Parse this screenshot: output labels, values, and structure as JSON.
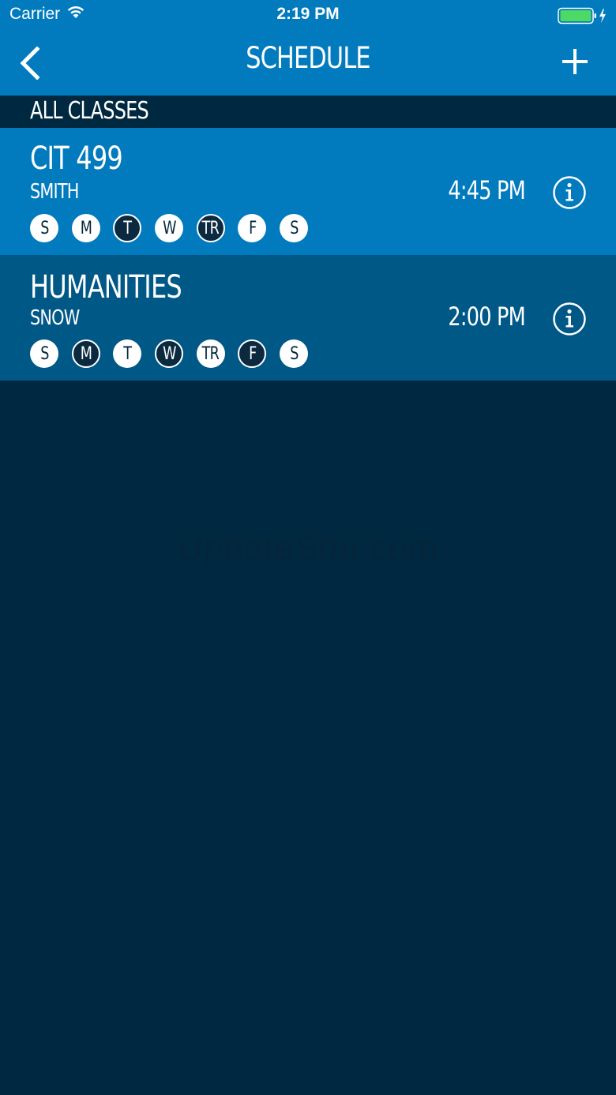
{
  "status_bar": {
    "carrier": "Carrier",
    "time": "2:19 PM"
  },
  "nav": {
    "title": "SCHEDULE"
  },
  "section": {
    "title": "ALL CLASSES"
  },
  "classes": [
    {
      "name": "CIT 499",
      "instructor": "SMITH",
      "time": "4:45 PM",
      "days": [
        {
          "label": "S",
          "selected": false
        },
        {
          "label": "M",
          "selected": false
        },
        {
          "label": "T",
          "selected": true
        },
        {
          "label": "W",
          "selected": false
        },
        {
          "label": "TR",
          "selected": true
        },
        {
          "label": "F",
          "selected": false
        },
        {
          "label": "S",
          "selected": false
        }
      ]
    },
    {
      "name": "HUMANITIES",
      "instructor": "SNOW",
      "time": "2:00 PM",
      "days": [
        {
          "label": "S",
          "selected": false
        },
        {
          "label": "M",
          "selected": true
        },
        {
          "label": "T",
          "selected": false
        },
        {
          "label": "W",
          "selected": true
        },
        {
          "label": "TR",
          "selected": false
        },
        {
          "label": "F",
          "selected": true
        },
        {
          "label": "S",
          "selected": false
        }
      ]
    }
  ],
  "watermark": "UpdateStar.com",
  "colors": {
    "nav_blue": "#017bbe",
    "row_alt_blue": "#005887",
    "background_navy": "#002840",
    "battery_green": "#4cd964"
  },
  "icons": {
    "back": "chevron-left-icon",
    "add": "plus-icon",
    "info": "info-circle-icon",
    "wifi": "wifi-icon",
    "battery": "battery-charging-icon"
  }
}
